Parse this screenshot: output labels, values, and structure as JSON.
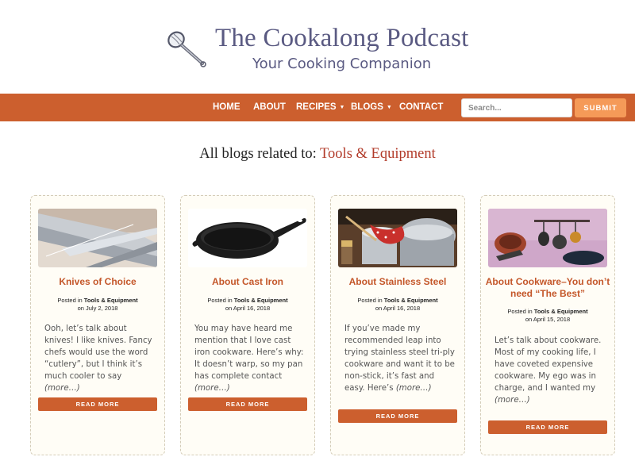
{
  "site": {
    "title": "The Cookalong Podcast",
    "tagline": "Your Cooking Companion",
    "logo_icon": "whisk-icon"
  },
  "nav": {
    "items": [
      {
        "label": "HOME",
        "dropdown": false
      },
      {
        "label": "ABOUT",
        "dropdown": false
      },
      {
        "label": "RECIPES",
        "dropdown": true
      },
      {
        "label": "BLOGS",
        "dropdown": true
      },
      {
        "label": "CONTACT",
        "dropdown": false
      }
    ],
    "search_placeholder": "Search...",
    "submit_label": "SUBMIT"
  },
  "heading": {
    "prefix": "All blogs related to:",
    "category": "Tools & Equipment"
  },
  "posts": [
    {
      "title": "Knives of Choice",
      "posted_in_label": "Posted in",
      "category": "Tools & Equipment",
      "date": "on July 2, 2018",
      "excerpt": "Ooh, let’s talk about knives! I like knives. Fancy chefs would use the word “cutlery”, but I think it’s much cooler to say",
      "more": "(more…)",
      "read_more": "READ MORE",
      "image": "knives-image"
    },
    {
      "title": "About Cast Iron",
      "posted_in_label": "Posted in",
      "category": "Tools & Equipment",
      "date": "on April 16, 2018",
      "excerpt": "You may have heard me mention that I love cast iron cookware. Here’s why: It doesn’t warp, so my pan has complete contact",
      "more": "(more…)",
      "read_more": "READ MORE",
      "image": "cast-iron-skillet-image"
    },
    {
      "title": "About Stainless Steel",
      "posted_in_label": "Posted in",
      "category": "Tools & Equipment",
      "date": "on April 16, 2018",
      "excerpt": "If you’ve made my recommended leap into trying stainless steel tri-ply cookware and want it to be non-stick, it’s fast and easy. Here’s",
      "more": "(more…)",
      "read_more": "READ MORE",
      "image": "stainless-pots-image"
    },
    {
      "title": "About Cookware–You don’t need “The Best”",
      "posted_in_label": "Posted in",
      "category": "Tools & Equipment",
      "date": "on April 15, 2018",
      "excerpt": "Let’s talk about cookware. Most of my cooking life, I have coveted expensive cookware. My ego was in charge, and I wanted my",
      "more": "(more…)",
      "read_more": "READ MORE",
      "image": "hanging-cookware-image"
    }
  ],
  "colors": {
    "accent": "#cc5f2e",
    "submit": "#f59a58",
    "title_text": "#5a5a82",
    "card_bg": "#fffdf6",
    "heading_category": "#b23b2a"
  }
}
